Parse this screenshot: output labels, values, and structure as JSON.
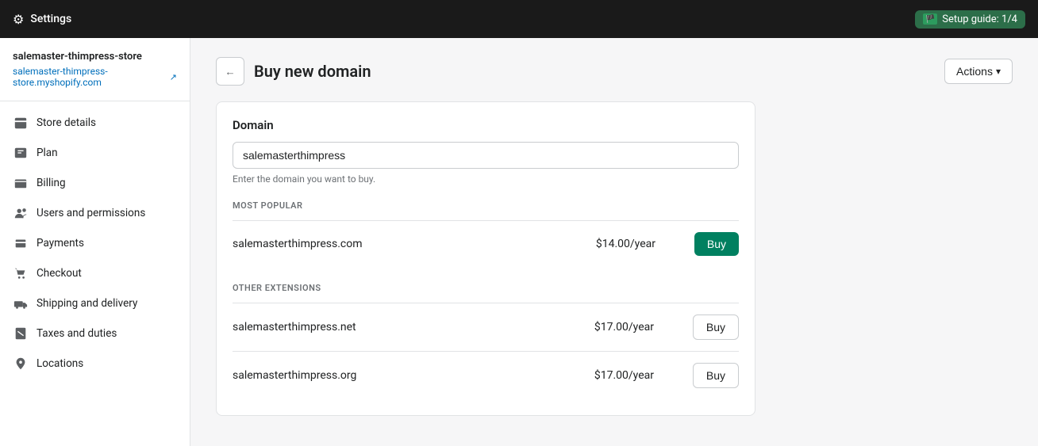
{
  "topbar": {
    "settings_label": "Settings",
    "setup_guide_label": "Setup guide: 1/4"
  },
  "sidebar": {
    "store_name": "salemaster-thimpress-store",
    "store_url": "salemaster-thimpress-store.myshopify.com",
    "nav_items": [
      {
        "id": "store-details",
        "label": "Store details",
        "icon": "store"
      },
      {
        "id": "plan",
        "label": "Plan",
        "icon": "plan"
      },
      {
        "id": "billing",
        "label": "Billing",
        "icon": "billing"
      },
      {
        "id": "users-permissions",
        "label": "Users and permissions",
        "icon": "users"
      },
      {
        "id": "payments",
        "label": "Payments",
        "icon": "payments"
      },
      {
        "id": "checkout",
        "label": "Checkout",
        "icon": "checkout"
      },
      {
        "id": "shipping-delivery",
        "label": "Shipping and delivery",
        "icon": "shipping"
      },
      {
        "id": "taxes-duties",
        "label": "Taxes and duties",
        "icon": "taxes"
      },
      {
        "id": "locations",
        "label": "Locations",
        "icon": "locations"
      }
    ]
  },
  "page": {
    "title": "Buy new domain",
    "actions_label": "Actions",
    "back_label": "←"
  },
  "domain_card": {
    "card_title": "Domain",
    "input_value": "salemasterthimpress",
    "input_hint": "Enter the domain you want to buy.",
    "most_popular_label": "MOST POPULAR",
    "other_extensions_label": "OTHER EXTENSIONS",
    "domains": [
      {
        "name": "salemasterthimpress.com",
        "price": "$14.00/year",
        "type": "popular",
        "buy_label": "Buy"
      },
      {
        "name": "salemasterthimpress.net",
        "price": "$17.00/year",
        "type": "other",
        "buy_label": "Buy"
      },
      {
        "name": "salemasterthimpress.org",
        "price": "$17.00/year",
        "type": "other",
        "buy_label": "Buy"
      }
    ]
  }
}
